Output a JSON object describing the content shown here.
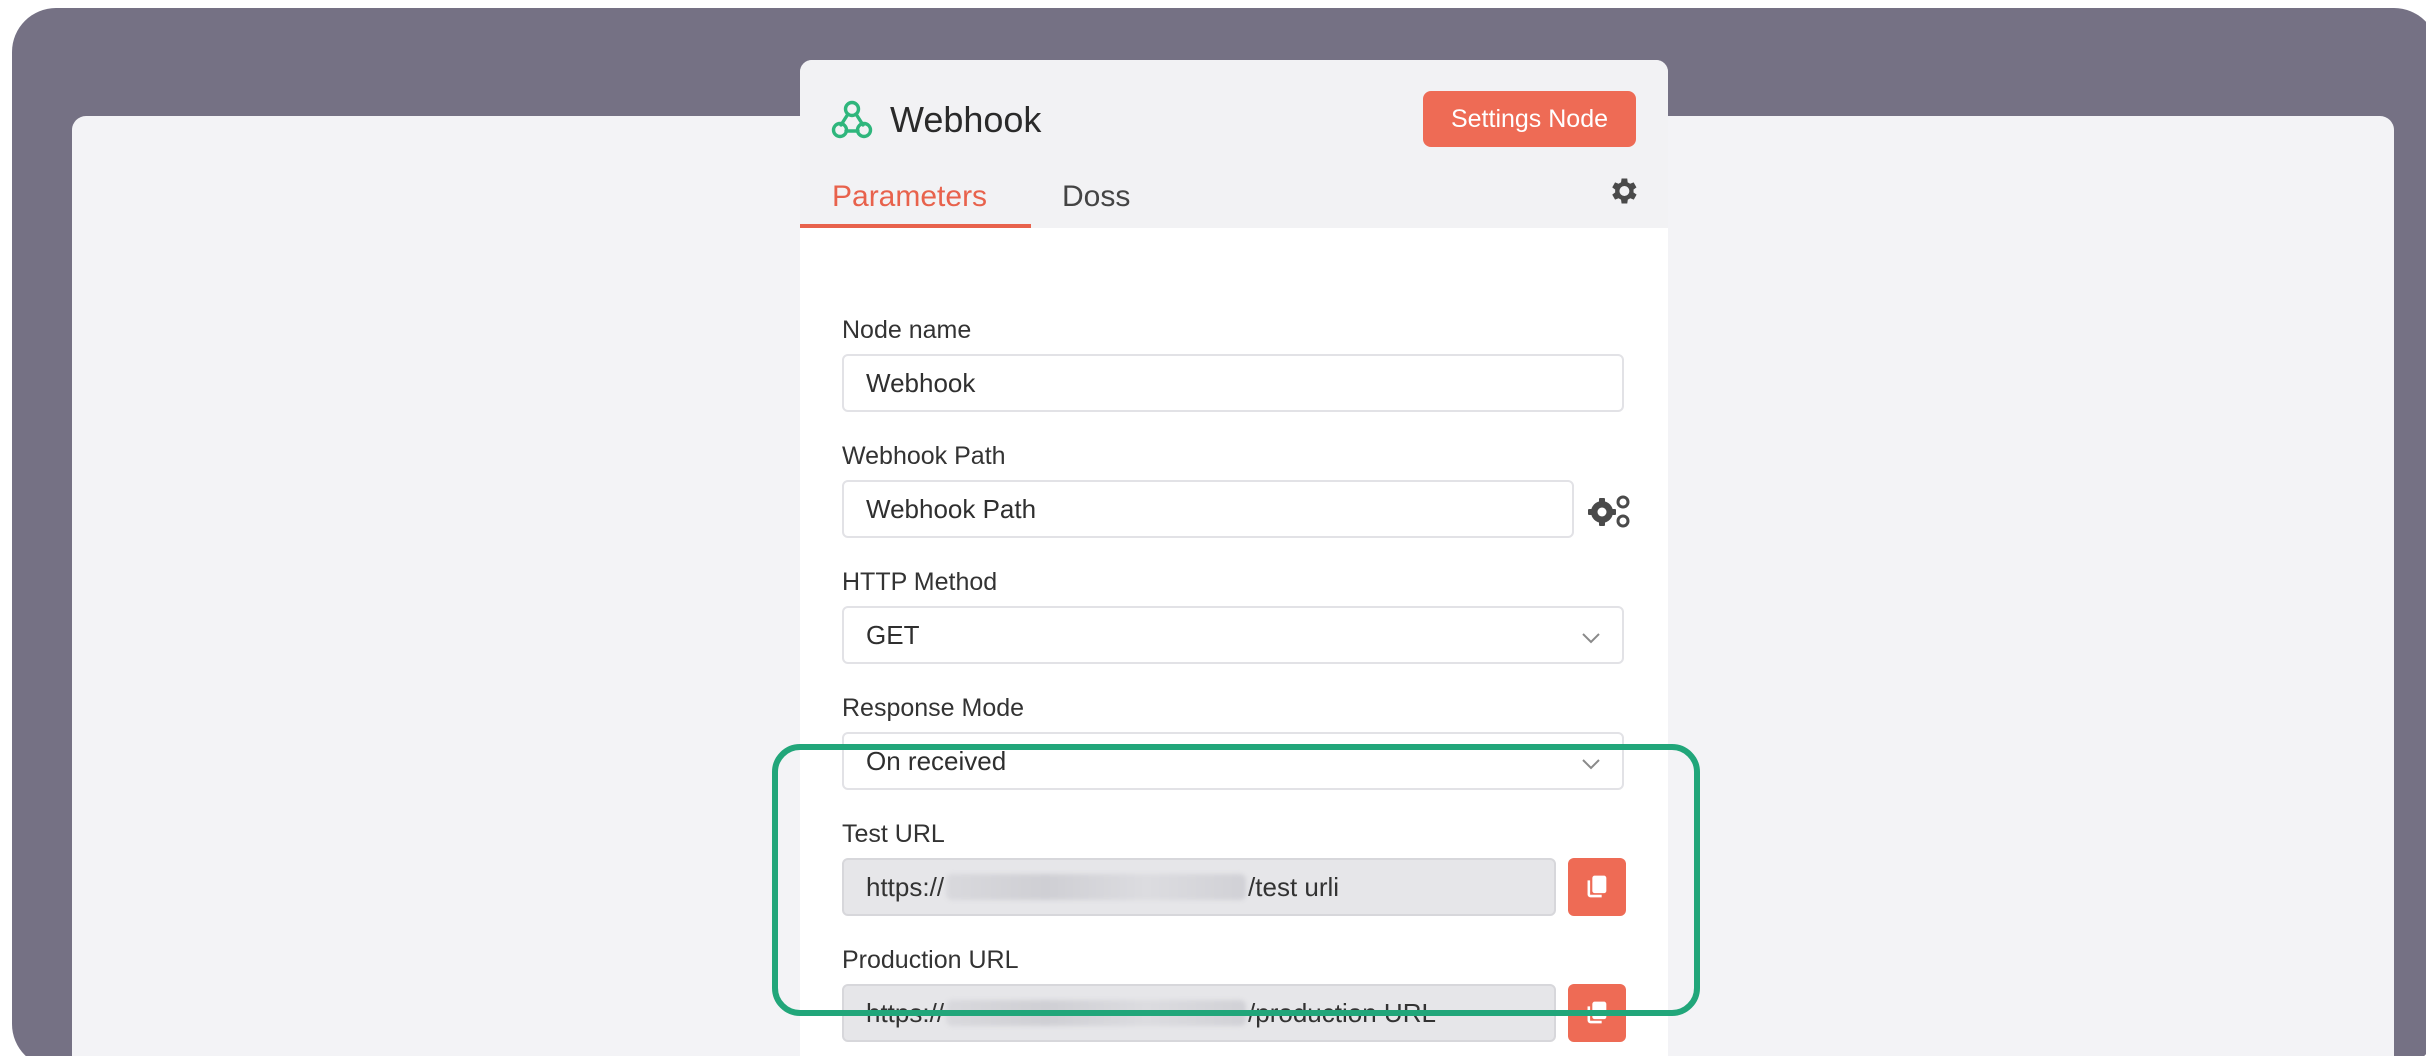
{
  "node": {
    "title": "Webhook",
    "icon": "webhook-icon",
    "settings_button": "Settings Node"
  },
  "tabs": [
    {
      "label": "Parameters",
      "active": true
    },
    {
      "label": "Doss",
      "active": false
    }
  ],
  "fields": {
    "node_name": {
      "label": "Node name",
      "value": "Webhook"
    },
    "webhook_path": {
      "label": "Webhook Path",
      "value": "Webhook Path"
    },
    "http_method": {
      "label": "HTTP Method",
      "value": "GET"
    },
    "response_mode": {
      "label": "Response Mode",
      "value": "On received"
    },
    "test_url": {
      "label": "Test URL",
      "prefix": "https://",
      "suffix": "/test urli"
    },
    "production_url": {
      "label": "Production URL",
      "prefix": "https://",
      "suffix": "/production URL"
    }
  },
  "colors": {
    "accent": "#ee6b55",
    "highlight": "#21a67a",
    "brand_icon": "#2fb67c",
    "frame": "#757184"
  }
}
